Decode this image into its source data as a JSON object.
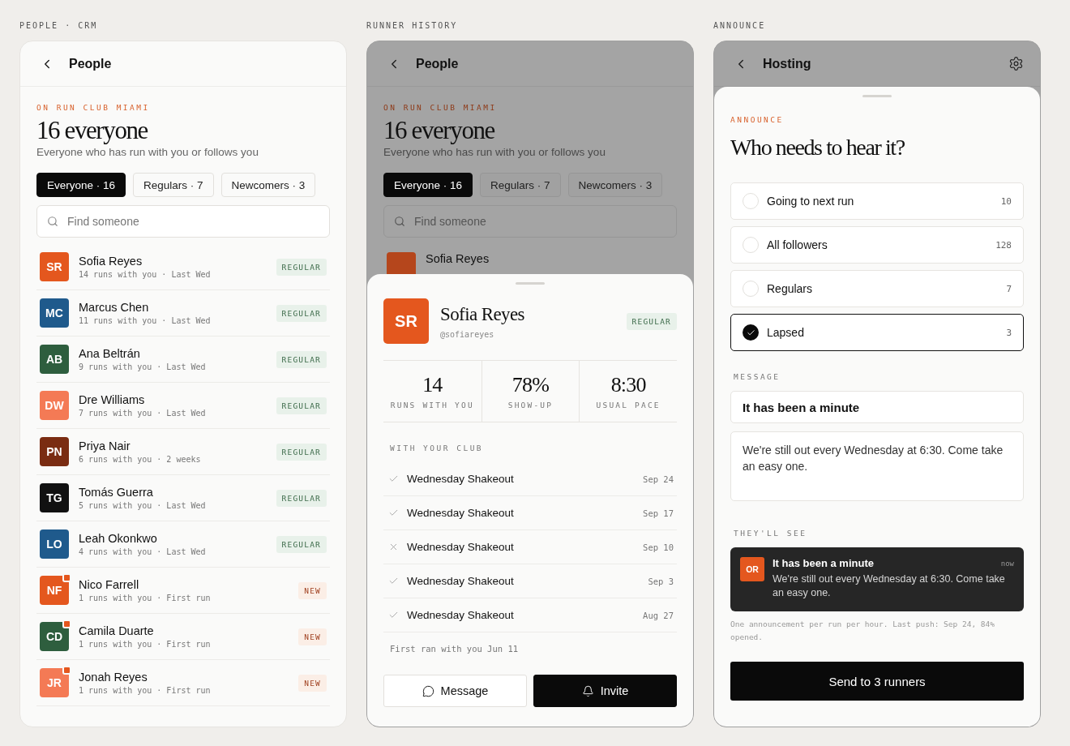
{
  "people_crm": {
    "label": "PEOPLE · CRM",
    "header": {
      "title": "People"
    },
    "eyebrow": "ON RUN CLUB MIAMI",
    "title": "16 everyone",
    "subtitle": "Everyone who has run with you or follows you",
    "filters": [
      {
        "label": "Everyone · 16",
        "selected": true
      },
      {
        "label": "Regulars · 7",
        "selected": false
      },
      {
        "label": "Newcomers · 3",
        "selected": false
      }
    ],
    "search": {
      "placeholder": "Find someone"
    },
    "people": [
      {
        "initials": "SR",
        "color": "#e4571e",
        "name": "Sofia Reyes",
        "meta": "14 runs with you · Last Wed",
        "badge": {
          "kind": "regular",
          "text": "REGULAR"
        },
        "has_dot": false
      },
      {
        "initials": "MC",
        "color": "#1f5a8c",
        "name": "Marcus Chen",
        "meta": "11 runs with you · Last Wed",
        "badge": {
          "kind": "regular",
          "text": "REGULAR"
        },
        "has_dot": false
      },
      {
        "initials": "AB",
        "color": "#2e5e3e",
        "name": "Ana Beltrán",
        "meta": "9 runs with you · Last Wed",
        "badge": {
          "kind": "regular",
          "text": "REGULAR"
        },
        "has_dot": false
      },
      {
        "initials": "DW",
        "color": "#f47a55",
        "name": "Dre Williams",
        "meta": "7 runs with you · Last Wed",
        "badge": {
          "kind": "regular",
          "text": "REGULAR"
        },
        "has_dot": false
      },
      {
        "initials": "PN",
        "color": "#7a2c12",
        "name": "Priya Nair",
        "meta": "6 runs with you · 2 weeks",
        "badge": {
          "kind": "regular",
          "text": "REGULAR"
        },
        "has_dot": false
      },
      {
        "initials": "TG",
        "color": "#111111",
        "name": "Tomás Guerra",
        "meta": "5 runs with you · Last Wed",
        "badge": {
          "kind": "regular",
          "text": "REGULAR"
        },
        "has_dot": false
      },
      {
        "initials": "LO",
        "color": "#1f5a8c",
        "name": "Leah Okonkwo",
        "meta": "4 runs with you · Last Wed",
        "badge": {
          "kind": "regular",
          "text": "REGULAR"
        },
        "has_dot": false
      },
      {
        "initials": "NF",
        "color": "#e4571e",
        "name": "Nico Farrell",
        "meta": "1 runs with you · First run",
        "badge": {
          "kind": "new",
          "text": "NEW"
        },
        "has_dot": true
      },
      {
        "initials": "CD",
        "color": "#2e5e3e",
        "name": "Camila Duarte",
        "meta": "1 runs with you · First run",
        "badge": {
          "kind": "new",
          "text": "NEW"
        },
        "has_dot": true
      },
      {
        "initials": "JR",
        "color": "#f47a55",
        "name": "Jonah Reyes",
        "meta": "1 runs with you · First run",
        "badge": {
          "kind": "new",
          "text": "NEW"
        },
        "has_dot": true
      }
    ]
  },
  "runner_history": {
    "label": "RUNNER HISTORY",
    "background": {
      "header": {
        "title": "People"
      },
      "eyebrow": "ON RUN CLUB MIAMI",
      "title": "16 everyone",
      "subtitle": "Everyone who has run with you or follows you",
      "filters": [
        {
          "label": "Everyone · 16",
          "selected": true
        },
        {
          "label": "Regulars · 7",
          "selected": false
        },
        {
          "label": "Newcomers · 3",
          "selected": false
        }
      ],
      "search": {
        "placeholder": "Find someone"
      },
      "peek_row": {
        "color": "#b5461c",
        "name": "Sofia Reyes"
      }
    },
    "sheet": {
      "initials": "SR",
      "color": "#e4571e",
      "name": "Sofia Reyes",
      "handle": "@sofiareyes",
      "badge": {
        "kind": "regular",
        "text": "REGULAR"
      },
      "stats": [
        {
          "value": "14",
          "label": "RUNS WITH YOU"
        },
        {
          "value": "78%",
          "label": "SHOW-UP"
        },
        {
          "value": "8:30",
          "label": "USUAL PACE"
        }
      ],
      "section_label": "WITH YOUR CLUB",
      "runs": [
        {
          "name": "Wednesday Shakeout",
          "date": "Sep 24",
          "attended": true
        },
        {
          "name": "Wednesday Shakeout",
          "date": "Sep 17",
          "attended": true
        },
        {
          "name": "Wednesday Shakeout",
          "date": "Sep 10",
          "attended": false
        },
        {
          "name": "Wednesday Shakeout",
          "date": "Sep 3",
          "attended": true
        },
        {
          "name": "Wednesday Shakeout",
          "date": "Aug 27",
          "attended": true
        }
      ],
      "footnote": "First ran with you Jun 11",
      "actions": [
        {
          "label": "Message",
          "kind": "secondary"
        },
        {
          "label": "Invite",
          "kind": "primary"
        }
      ]
    }
  },
  "announce": {
    "label": "ANNOUNCE",
    "header": {
      "title": "Hosting"
    },
    "eyebrow": "ANNOUNCE",
    "title": "Who needs to hear it?",
    "audiences": [
      {
        "label": "Going to next run",
        "count": "10",
        "selected": false
      },
      {
        "label": "All followers",
        "count": "128",
        "selected": false
      },
      {
        "label": "Regulars",
        "count": "7",
        "selected": false
      },
      {
        "label": "Lapsed",
        "count": "3",
        "selected": true
      }
    ],
    "message_label": "MESSAGE",
    "subject": {
      "value": "It has been a minute"
    },
    "body": {
      "value": "We're still out every Wednesday at 6:30. Come take an easy one."
    },
    "preview_label": "THEY'LL SEE",
    "preview": {
      "initials": "OR",
      "color": "#e4571e",
      "title": "It has been a minute",
      "time": "now",
      "body": "We're still out every Wednesday at 6:30. Come take an easy one."
    },
    "footnote": "One announcement per run per hour. Last push: Sep 24, 84% opened.",
    "send_button": "Send to 3 runners"
  }
}
